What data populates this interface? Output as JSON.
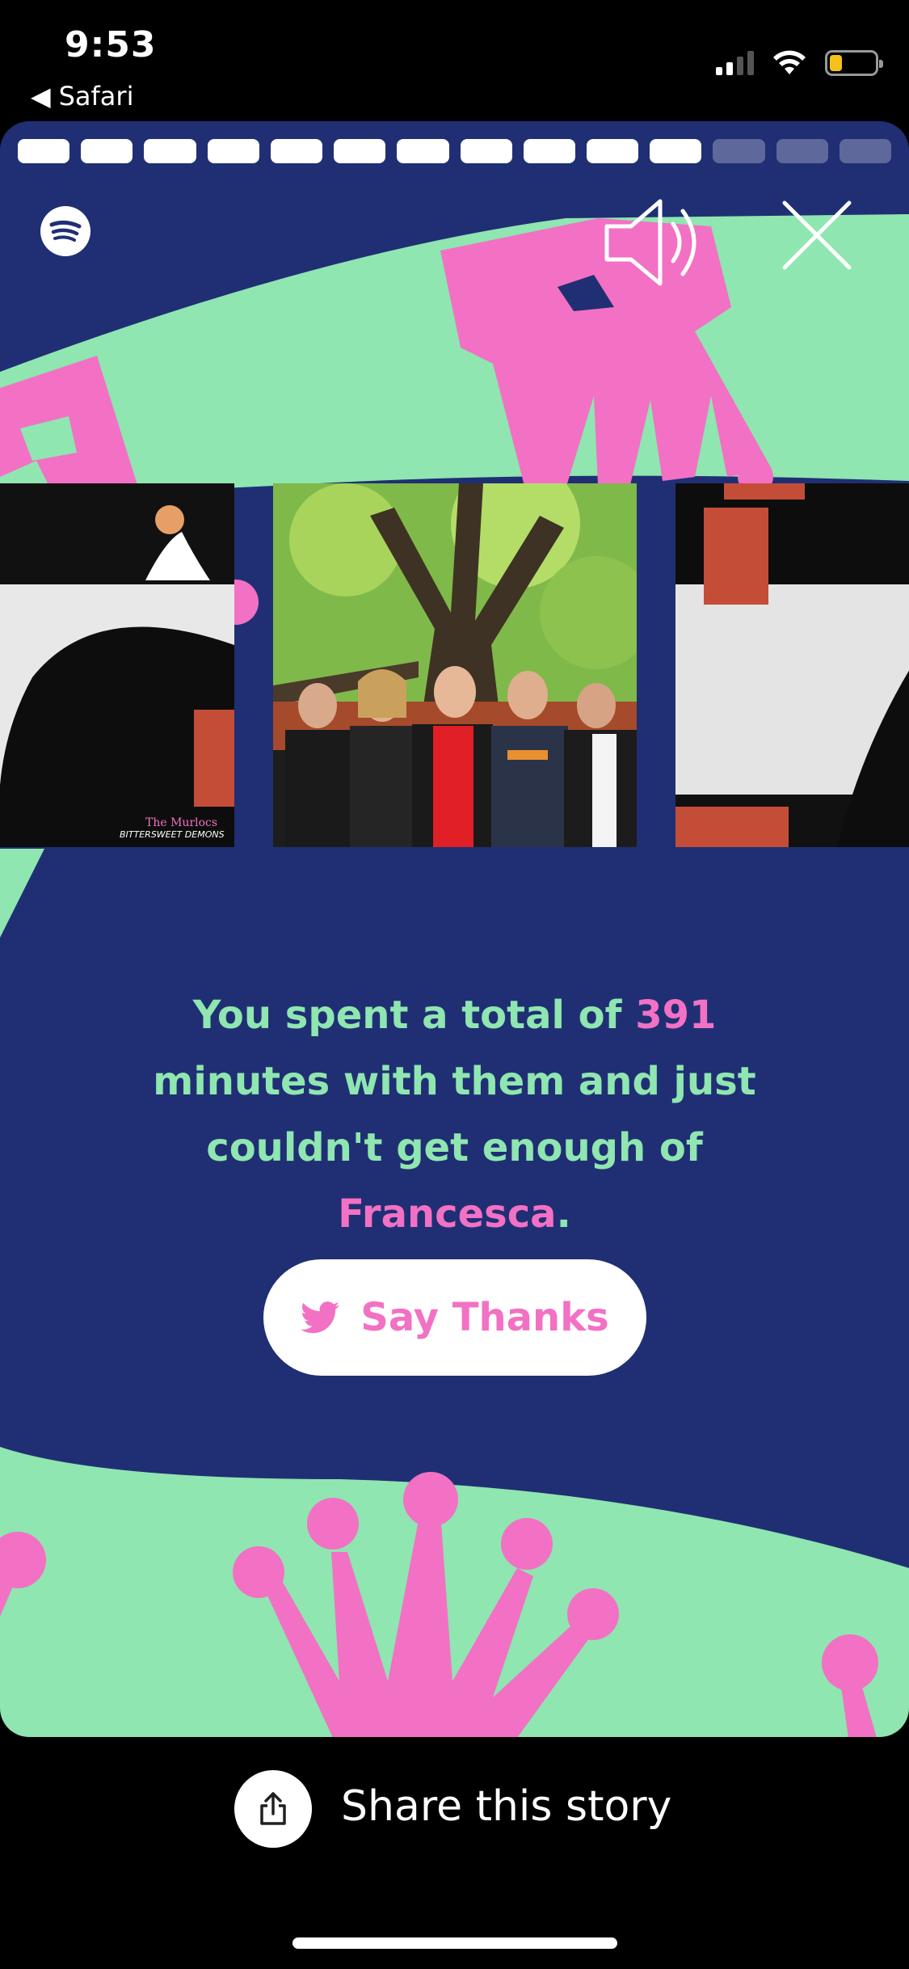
{
  "status_bar": {
    "time": "9:53",
    "back_app": "Safari",
    "battery_color": "#f5c11a"
  },
  "story": {
    "progress_total": 14,
    "progress_completed": 11,
    "colors": {
      "background": "#202f74",
      "mint": "#8fe6b0",
      "pink": "#f271c4"
    },
    "caption": {
      "part1": "You spent a total of ",
      "minutes": "391",
      "part2": " minutes with them and just couldn't get enough of ",
      "song": "Francesca",
      "part3": "."
    },
    "say_thanks": {
      "label": "Say Thanks",
      "icon": "twitter-bird-icon"
    },
    "album_covers": [
      {
        "artist": "The Murlocs",
        "title": "BITTERSWEET DEMONS"
      },
      {
        "artist": "",
        "title": ""
      },
      {
        "artist": "",
        "title": ""
      }
    ]
  },
  "share": {
    "label": "Share this story",
    "icon": "share-icon"
  }
}
